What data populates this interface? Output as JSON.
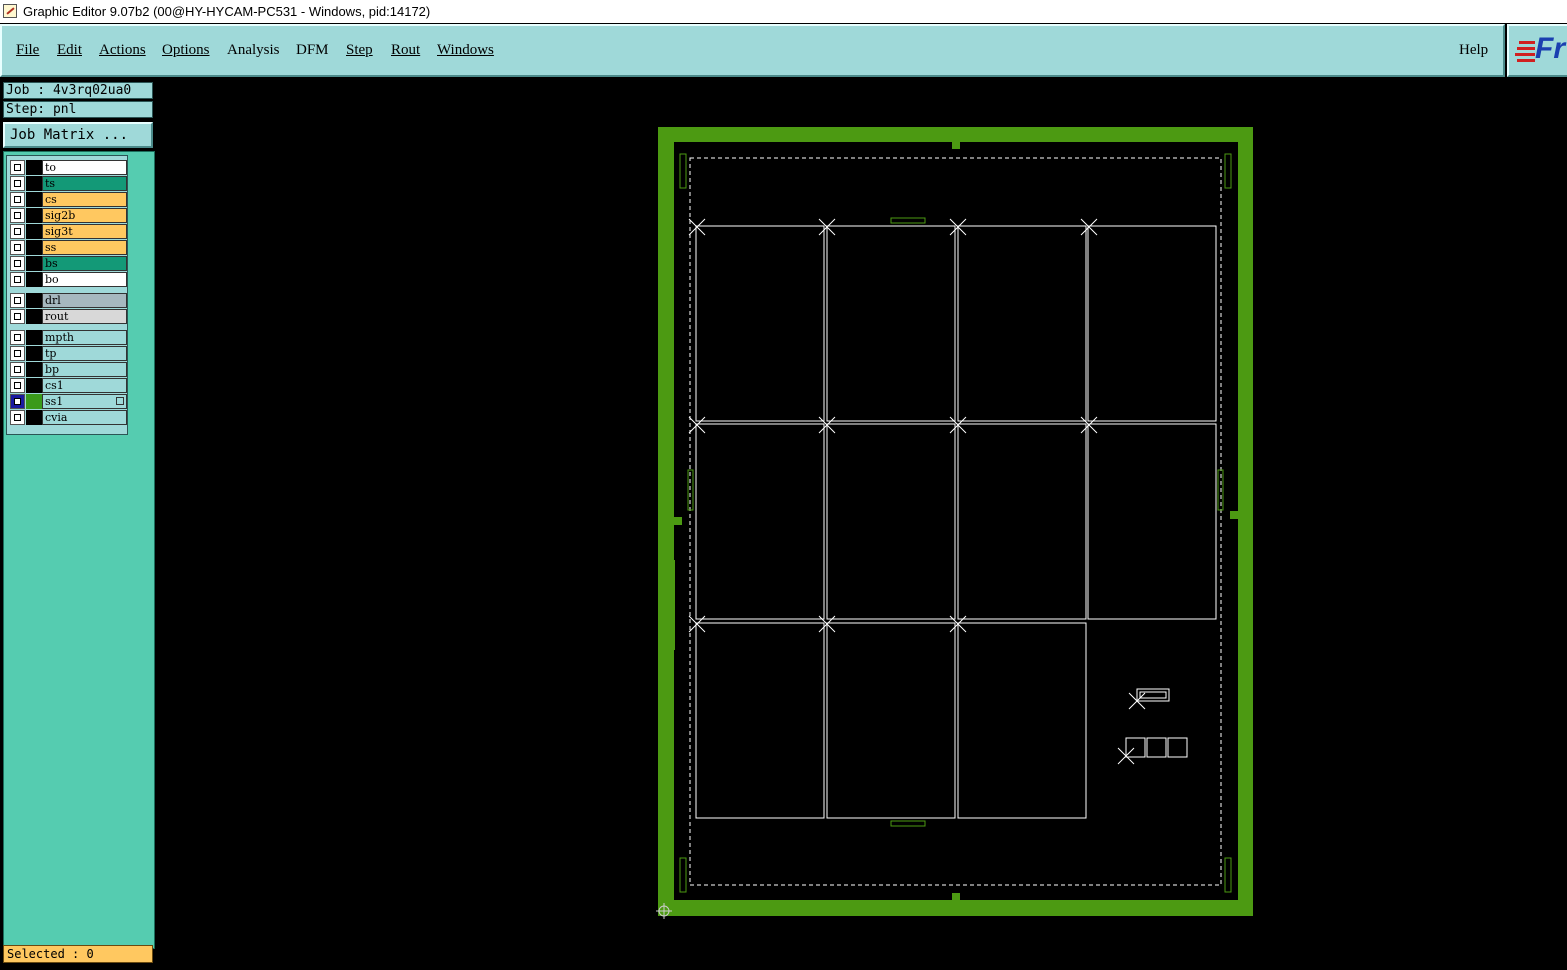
{
  "window": {
    "title": "Graphic Editor 9.07b2 (00@HY-HYCAM-PC531 - Windows, pid:14172)"
  },
  "menu": {
    "items": [
      {
        "label": "File",
        "name": "menu-file"
      },
      {
        "label": "Edit",
        "name": "menu-edit"
      },
      {
        "label": "Actions",
        "name": "menu-actions"
      },
      {
        "label": "Options",
        "name": "menu-options"
      },
      {
        "label": "Analysis",
        "name": "menu-analysis"
      },
      {
        "label": "DFM",
        "name": "menu-dfm"
      },
      {
        "label": "Step",
        "name": "menu-step"
      },
      {
        "label": "Rout",
        "name": "menu-rout"
      },
      {
        "label": "Windows",
        "name": "menu-windows"
      }
    ],
    "help": "Help"
  },
  "logo": {
    "text": "Fr",
    "brand_color": "#1a3fb0"
  },
  "info": {
    "job": "Job : 4v3rq02ua0",
    "step": "Step: pnl",
    "job_matrix": "Job Matrix ..."
  },
  "layers": [
    {
      "name": "to",
      "color": "#ffffff",
      "active": false
    },
    {
      "name": "ts",
      "color": "#139977",
      "active": false
    },
    {
      "name": "cs",
      "color": "#ffc860",
      "active": false
    },
    {
      "name": "sig2b",
      "color": "#ffc860",
      "active": false
    },
    {
      "name": "sig3t",
      "color": "#ffc860",
      "active": false
    },
    {
      "name": "ss",
      "color": "#ffc860",
      "active": false
    },
    {
      "name": "bs",
      "color": "#139977",
      "active": false
    },
    {
      "name": "bo",
      "color": "#ffffff",
      "active": false
    },
    {
      "name": "drl",
      "color": "#a6b8bf",
      "active": false
    },
    {
      "name": "rout",
      "color": "#d8d8d8",
      "active": false
    },
    {
      "name": "mpth",
      "color": "#9fd9d9",
      "active": false
    },
    {
      "name": "tp",
      "color": "#9fd9d9",
      "active": false
    },
    {
      "name": "bp",
      "color": "#9fd9d9",
      "active": false
    },
    {
      "name": "cs1",
      "color": "#9fd9d9",
      "active": false
    },
    {
      "name": "ss1",
      "color": "#9fd9d9",
      "active": true
    },
    {
      "name": "cvia",
      "color": "#9fd9d9",
      "active": false
    }
  ],
  "status": {
    "selected": "Selected : 0"
  },
  "colors": {
    "panel_frame": "#4c9a12",
    "outline": "#ffffff",
    "background": "#000000",
    "menu_bg": "#9fd9d9"
  }
}
